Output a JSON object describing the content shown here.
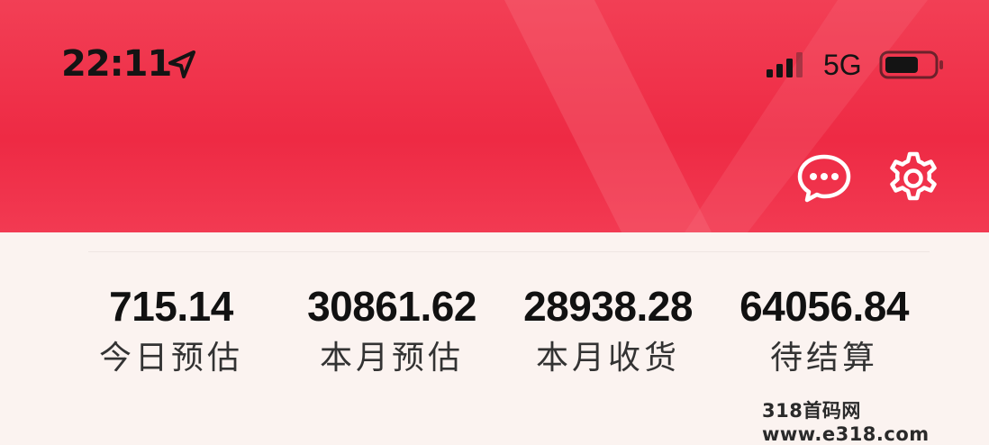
{
  "status_bar": {
    "time": "22:11",
    "network": "5G",
    "location_icon": "location-arrow-icon",
    "signal_icon": "cellular-signal-icon",
    "battery_icon": "battery-icon",
    "battery_level": 0.7
  },
  "header": {
    "accent_color": "#ef2f48",
    "icons": [
      "message-bubble-icon",
      "gear-icon"
    ]
  },
  "stats": [
    {
      "value": "715.14",
      "label": "今日预估"
    },
    {
      "value": "30861.62",
      "label": "本月预估"
    },
    {
      "value": "28938.28",
      "label": "本月收货"
    },
    {
      "value": "64056.84",
      "label": "待结算"
    }
  ],
  "watermark": "318首码网 www.e318.com"
}
